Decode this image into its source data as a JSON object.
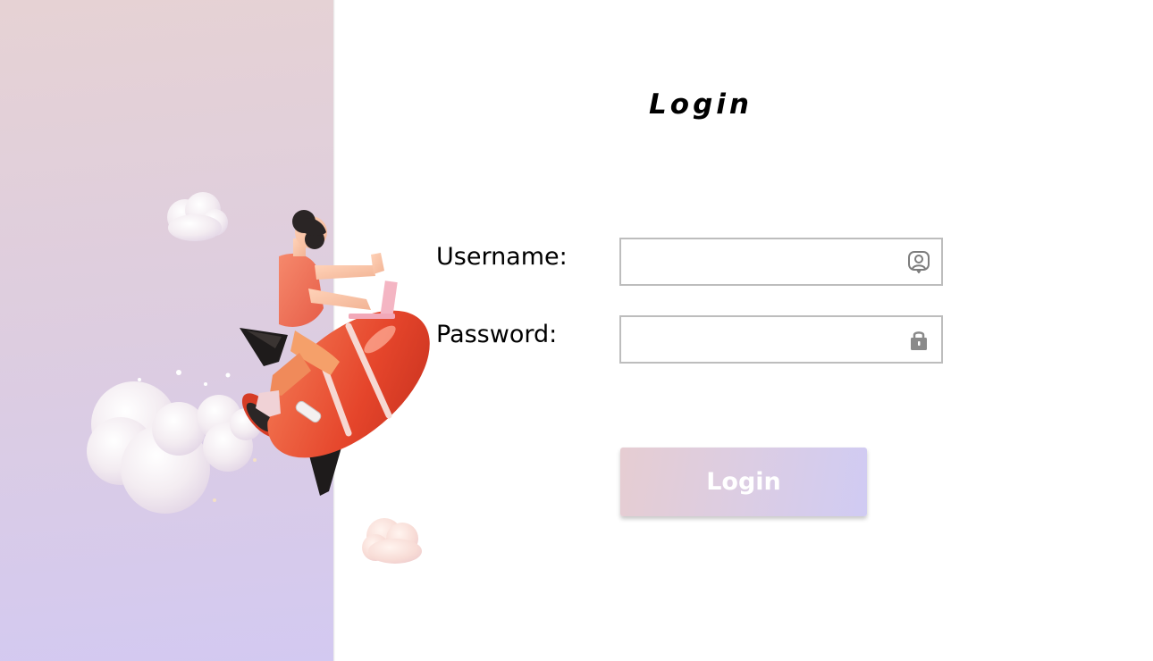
{
  "form": {
    "title": "Login",
    "username_label": "Username:",
    "username_value": "",
    "password_label": "Password:",
    "password_value": "",
    "submit_label": "Login"
  },
  "icons": {
    "username": "user-portrait-icon",
    "password": "lock-icon"
  },
  "colors": {
    "panel_top": "#e6d2d4",
    "panel_bottom": "#d3c9f1",
    "button_left": "#e6cdd2",
    "button_right": "#d0cbf3",
    "input_border": "#bdbdbd",
    "icon_gray": "#8a8a8a"
  }
}
